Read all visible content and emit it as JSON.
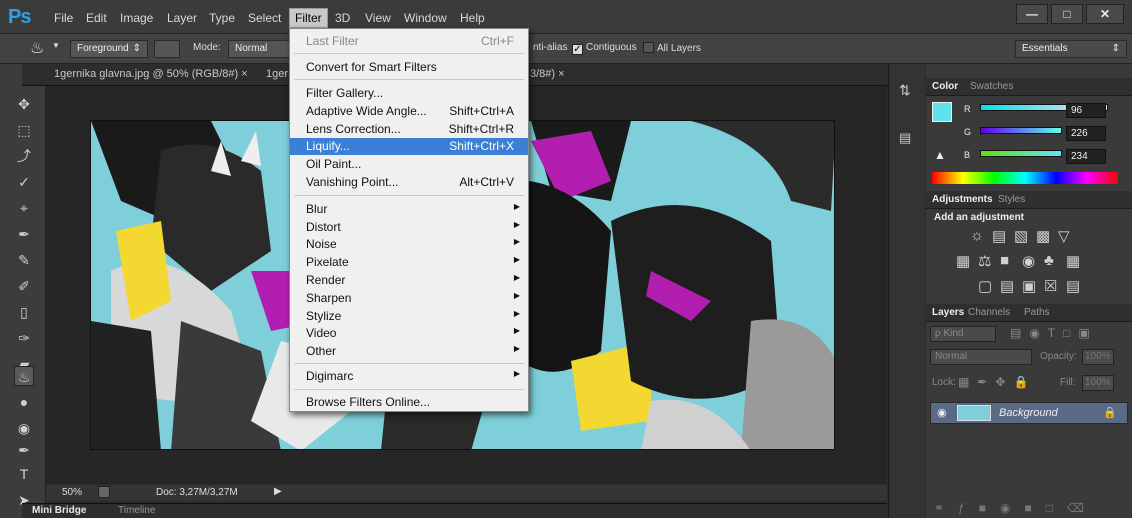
{
  "app": {
    "logo": "Ps"
  },
  "menubar": {
    "items": [
      "File",
      "Edit",
      "Image",
      "Layer",
      "Type",
      "Select",
      "Filter",
      "3D",
      "View",
      "Window",
      "Help"
    ],
    "active": "Filter"
  },
  "window_buttons": {
    "minimize": "—",
    "maximize": "□",
    "close": "✕"
  },
  "options": {
    "fill_source": "Foreground",
    "mode_label": "Mode:",
    "mode_value": "Normal",
    "anti_alias": "nti-alias",
    "contiguous": "Contiguous",
    "all_layers": "All Layers",
    "workspace": "Essentials"
  },
  "doc_tabs": [
    "1gernika glavna.jpg @ 50% (RGB/8#)",
    "1ger",
    "3/8#)"
  ],
  "filter_menu": {
    "items": [
      {
        "label": "Last Filter",
        "shortcut": "Ctrl+F",
        "disabled": true
      },
      {
        "label": "Convert for Smart Filters",
        "shortcut": ""
      },
      {
        "label": "Filter Gallery...",
        "shortcut": ""
      },
      {
        "label": "Adaptive Wide Angle...",
        "shortcut": "Shift+Ctrl+A"
      },
      {
        "label": "Lens Correction...",
        "shortcut": "Shift+Ctrl+R"
      },
      {
        "label": "Liquify...",
        "shortcut": "Shift+Ctrl+X",
        "highlighted": true
      },
      {
        "label": "Oil Paint...",
        "shortcut": ""
      },
      {
        "label": "Vanishing Point...",
        "shortcut": "Alt+Ctrl+V"
      },
      {
        "label": "Blur",
        "submenu": true
      },
      {
        "label": "Distort",
        "submenu": true
      },
      {
        "label": "Noise",
        "submenu": true
      },
      {
        "label": "Pixelate",
        "submenu": true
      },
      {
        "label": "Render",
        "submenu": true
      },
      {
        "label": "Sharpen",
        "submenu": true
      },
      {
        "label": "Stylize",
        "submenu": true
      },
      {
        "label": "Video",
        "submenu": true
      },
      {
        "label": "Other",
        "submenu": true
      },
      {
        "label": "Digimarc",
        "submenu": true
      },
      {
        "label": "Browse Filters Online..."
      }
    ]
  },
  "status": {
    "zoom": "50%",
    "doc": "Doc: 3,27M/3,27M"
  },
  "bottom_tabs": [
    "Mini Bridge",
    "Timeline"
  ],
  "color_panel": {
    "tabs": [
      "Color",
      "Swatches"
    ],
    "channels": [
      {
        "name": "R",
        "value": "96"
      },
      {
        "name": "G",
        "value": "226"
      },
      {
        "name": "B",
        "value": "234"
      }
    ],
    "swatch_color": "#60e2ea"
  },
  "adjustments_panel": {
    "tabs": [
      "Adjustments",
      "Styles"
    ],
    "heading": "Add an adjustment"
  },
  "layers_panel": {
    "tabs": [
      "Layers",
      "Channels",
      "Paths"
    ],
    "kind": "ρ Kind",
    "blend": "Normal",
    "opacity_label": "Opacity:",
    "opacity_value": "100%",
    "lock_label": "Lock:",
    "fill_label": "Fill:",
    "fill_value": "100%",
    "layer_name": "Background"
  }
}
